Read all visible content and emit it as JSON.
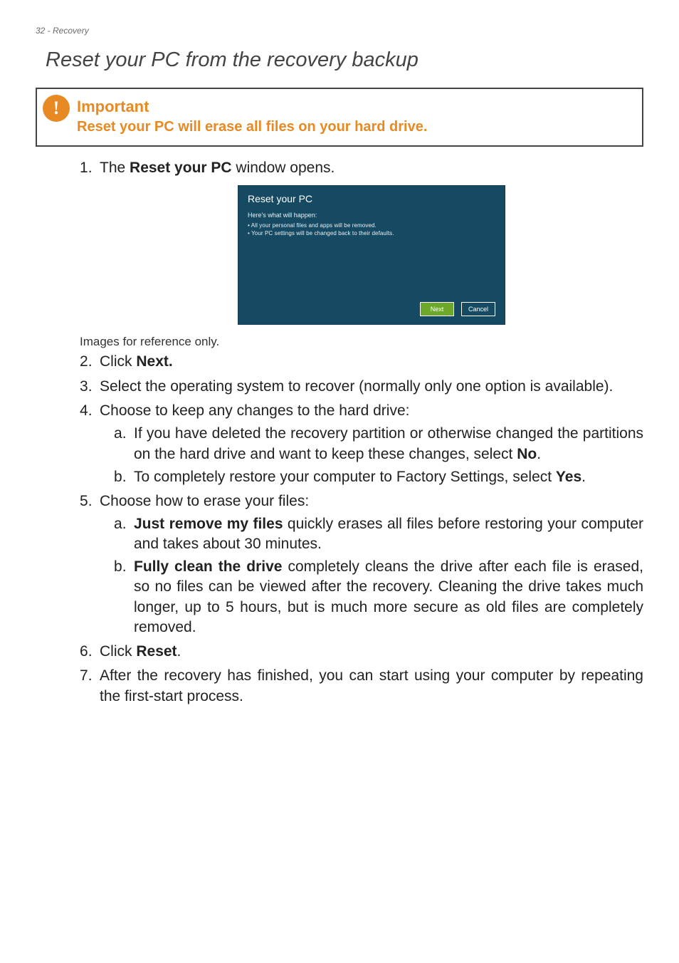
{
  "header": {
    "page_indicator": "32 - Recovery"
  },
  "title": "Reset your PC from the recovery backup",
  "callout": {
    "icon_glyph": "!",
    "heading": "Important",
    "body": "Reset your PC will erase all files on your hard drive."
  },
  "screenshot": {
    "title": "Reset your PC",
    "subtitle": "Here's what will happen:",
    "bullet1": "• All your personal files and apps will be removed.",
    "bullet2": "• Your PC settings will be changed back to their defaults.",
    "next_label": "Next",
    "cancel_label": "Cancel"
  },
  "reference_note": "Images for reference only.",
  "steps": {
    "s1_a": "The ",
    "s1_b": "Reset your PC",
    "s1_c": " window opens.",
    "s2_a": "Click ",
    "s2_b": "Next.",
    "s3": "Select the operating system to recover (normally only one option is available).",
    "s4": "Choose to keep any changes to the hard drive:",
    "s4a_a": "If you have deleted the recovery partition or otherwise changed the partitions on the hard drive and want to keep these changes, select ",
    "s4a_b": "No",
    "s4a_c": ".",
    "s4b_a": "To completely restore your computer to Factory Settings, select ",
    "s4b_b": "Yes",
    "s4b_c": ".",
    "s5": "Choose how to erase your files:",
    "s5a_a": "Just remove my files",
    "s5a_b": " quickly erases all files before restoring your computer and takes about 30 minutes.",
    "s5b_a": "Fully clean the drive",
    "s5b_b": " completely cleans the drive after each file is erased, so no files can be viewed after the recovery. Cleaning the drive takes much longer, up to 5 hours, but is much more secure as old files are completely removed.",
    "s6_a": "Click ",
    "s6_b": "Reset",
    "s6_c": ".",
    "s7": "After the recovery has finished, you can start using your computer by repeating the first-start process."
  }
}
